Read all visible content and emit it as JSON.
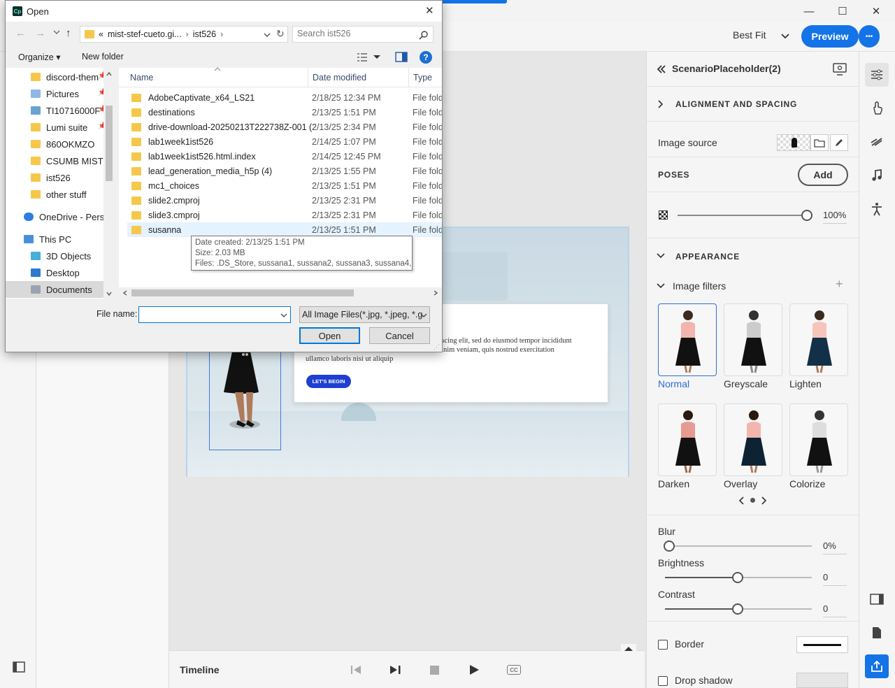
{
  "app": {
    "window_controls": {
      "minimize": "—",
      "maximize": "☐",
      "close": "✕"
    },
    "zoom_label": "Best Fit",
    "preview_label": "Preview",
    "more_label": "•••",
    "timeline": {
      "label": "Timeline"
    },
    "slide": {
      "body_line1": "dipiscing elit, sed do eiusmod tempor incididunt",
      "body_line2": "d minim veniam, quis nostrud exercitation",
      "body_line3": "ullamco laboris nisi ut aliquip",
      "cta_label": "LET'S BEGIN"
    }
  },
  "props": {
    "title": "ScenarioPlaceholder(2)",
    "alignment_label": "ALIGNMENT AND SPACING",
    "image_source_label": "Image source",
    "poses_label": "POSES",
    "add_label": "Add",
    "opacity_value": "100%",
    "appearance_label": "APPEARANCE",
    "image_filters_label": "Image filters",
    "filters": [
      {
        "label": "Normal"
      },
      {
        "label": "Greyscale"
      },
      {
        "label": "Lighten"
      },
      {
        "label": "Darken"
      },
      {
        "label": "Overlay"
      },
      {
        "label": "Colorize"
      }
    ],
    "blur_label": "Blur",
    "blur_value": "0%",
    "brightness_label": "Brightness",
    "brightness_value": "0",
    "contrast_label": "Contrast",
    "contrast_value": "0",
    "border_label": "Border",
    "shadow_label": "Drop shadow",
    "levels": {
      "opacity": 1.0,
      "blur": 0.0,
      "brightness": 0.5,
      "contrast": 0.5
    }
  },
  "dialog": {
    "title": "Open",
    "path": [
      "«",
      "mist-stef-cueto.gi...",
      "›",
      "ist526",
      "›"
    ],
    "search_placeholder": "Search ist526",
    "organize_label": "Organize ▾",
    "new_folder_label": "New folder",
    "nav_items": [
      {
        "label": "discord-them"
      },
      {
        "label": "Pictures"
      },
      {
        "label": "TI10716000F ("
      },
      {
        "label": "Lumi suite"
      },
      {
        "label": "860OKMZO"
      },
      {
        "label": "CSUMB MIST"
      },
      {
        "label": "ist526"
      },
      {
        "label": "other stuff"
      },
      {
        "label": "OneDrive - Persor"
      },
      {
        "label": "This PC"
      },
      {
        "label": "3D Objects"
      },
      {
        "label": "Desktop"
      },
      {
        "label": "Documents"
      }
    ],
    "columns": {
      "name": "Name",
      "date": "Date modified",
      "type": "Type"
    },
    "files": [
      {
        "name": "AdobeCaptivate_x64_LS21",
        "date": "2/18/25 12:34 PM",
        "type": "File fold"
      },
      {
        "name": "destinations",
        "date": "2/13/25 1:51 PM",
        "type": "File fold"
      },
      {
        "name": "drive-download-20250213T222738Z-001 (2)",
        "date": "2/13/25 2:34 PM",
        "type": "File fold"
      },
      {
        "name": "lab1week1ist526",
        "date": "2/14/25 1:07 PM",
        "type": "File fold"
      },
      {
        "name": "lab1week1ist526.html.index",
        "date": "2/14/25 12:45 PM",
        "type": "File fold"
      },
      {
        "name": "lead_generation_media_h5p (4)",
        "date": "2/13/25 1:55 PM",
        "type": "File fold"
      },
      {
        "name": "mc1_choices",
        "date": "2/13/25 1:51 PM",
        "type": "File fold"
      },
      {
        "name": "slide2.cmproj",
        "date": "2/13/25 2:31 PM",
        "type": "File fold"
      },
      {
        "name": "slide3.cmproj",
        "date": "2/13/25 2:31 PM",
        "type": "File fold"
      },
      {
        "name": "susanna",
        "date": "2/13/25 1:51 PM",
        "type": "File fold"
      }
    ],
    "tooltip": {
      "created": "Date created: 2/13/25 1:51 PM",
      "size": "Size: 2.03 MB",
      "files": "Files: .DS_Store, sussana1, sussana2, sussana3, sussana4, ..."
    },
    "filename_label": "File name:",
    "filename_value": "",
    "filetype_value": "All Image Files(*.jpg, *.jpeg, *.g",
    "open_label": "Open",
    "cancel_label": "Cancel"
  },
  "colors": {
    "accent": "#1473e6",
    "folder": "#f5c84c",
    "selection": "#cce8ff"
  }
}
